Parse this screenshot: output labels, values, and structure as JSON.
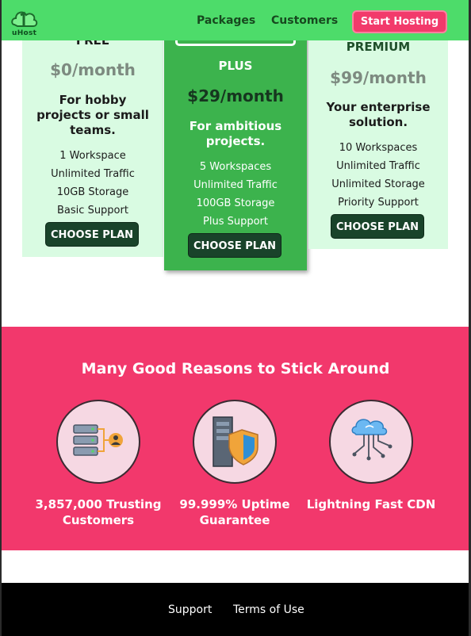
{
  "nav": {
    "logo_text": "uHost",
    "links": [
      "Packages",
      "Customers"
    ],
    "cta": "Start Hosting"
  },
  "plans": [
    {
      "name": "FREE",
      "price": "$0/month",
      "tagline": [
        "For hobby",
        "projects or small",
        "teams."
      ],
      "features": [
        "1 Workspace",
        "Unlimited Traffic",
        "10GB Storage",
        "Basic Support"
      ],
      "button": "CHOOSE PLAN"
    },
    {
      "name": "PLUS",
      "price": "$29/month",
      "tagline": [
        "For ambitious",
        "projects."
      ],
      "features": [
        "5 Workspaces",
        "Unlimited Traffic",
        "100GB Storage",
        "Plus Support"
      ],
      "button": "CHOOSE PLAN"
    },
    {
      "name": "PREMIUM",
      "price": "$99/month",
      "tagline": [
        "Your enterprise",
        "solution."
      ],
      "features": [
        "10 Workspaces",
        "Unlimited Traffic",
        "Unlimited Storage",
        "Priority Support"
      ],
      "button": "CHOOSE PLAN"
    }
  ],
  "reasons": {
    "title": "Many Good Reasons to Stick Around",
    "items": [
      {
        "icon": "server-users-icon",
        "label": [
          "3,857,000 Trusting",
          "Customers"
        ]
      },
      {
        "icon": "server-shield-icon",
        "label": [
          "99.999% Uptime",
          "Guarantee"
        ]
      },
      {
        "icon": "cloud-network-icon",
        "label": [
          "Lightning Fast CDN"
        ]
      }
    ]
  },
  "footer": {
    "links": [
      "Support",
      "Terms of Use"
    ]
  },
  "colors": {
    "nav_green": "#4ddc6a",
    "plus_green": "#3cb34d",
    "card_mint": "#d9fbe2",
    "accent_pink": "#f2386c",
    "button_dark_green": "#19432a"
  }
}
